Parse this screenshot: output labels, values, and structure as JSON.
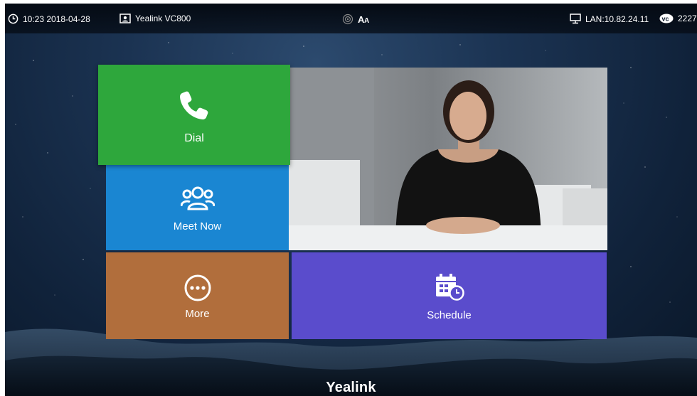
{
  "statusbar": {
    "clock": "10:23 2018-04-28",
    "device_name": "Yealink VC800",
    "lan": "LAN:10.82.24.11",
    "vc_id": "2227"
  },
  "tiles": {
    "dial": "Dial",
    "meet_now": "Meet Now",
    "more": "More",
    "schedule": "Schedule"
  },
  "brand": "Yealink",
  "colors": {
    "dial": "#2ea73c",
    "meet_now": "#1a86d2",
    "more": "#b16e3c",
    "schedule": "#5a4ccc"
  },
  "icons": {
    "clock": "clock-icon",
    "device": "contact-card-icon",
    "wireless": "wireless-presenter-icon",
    "text_size": "font-size-icon",
    "network": "monitor-network-icon",
    "vc": "vc-badge-icon",
    "dial": "phone-icon",
    "meet_now": "people-icon",
    "more": "ellipsis-icon",
    "schedule": "calendar-clock-icon"
  }
}
